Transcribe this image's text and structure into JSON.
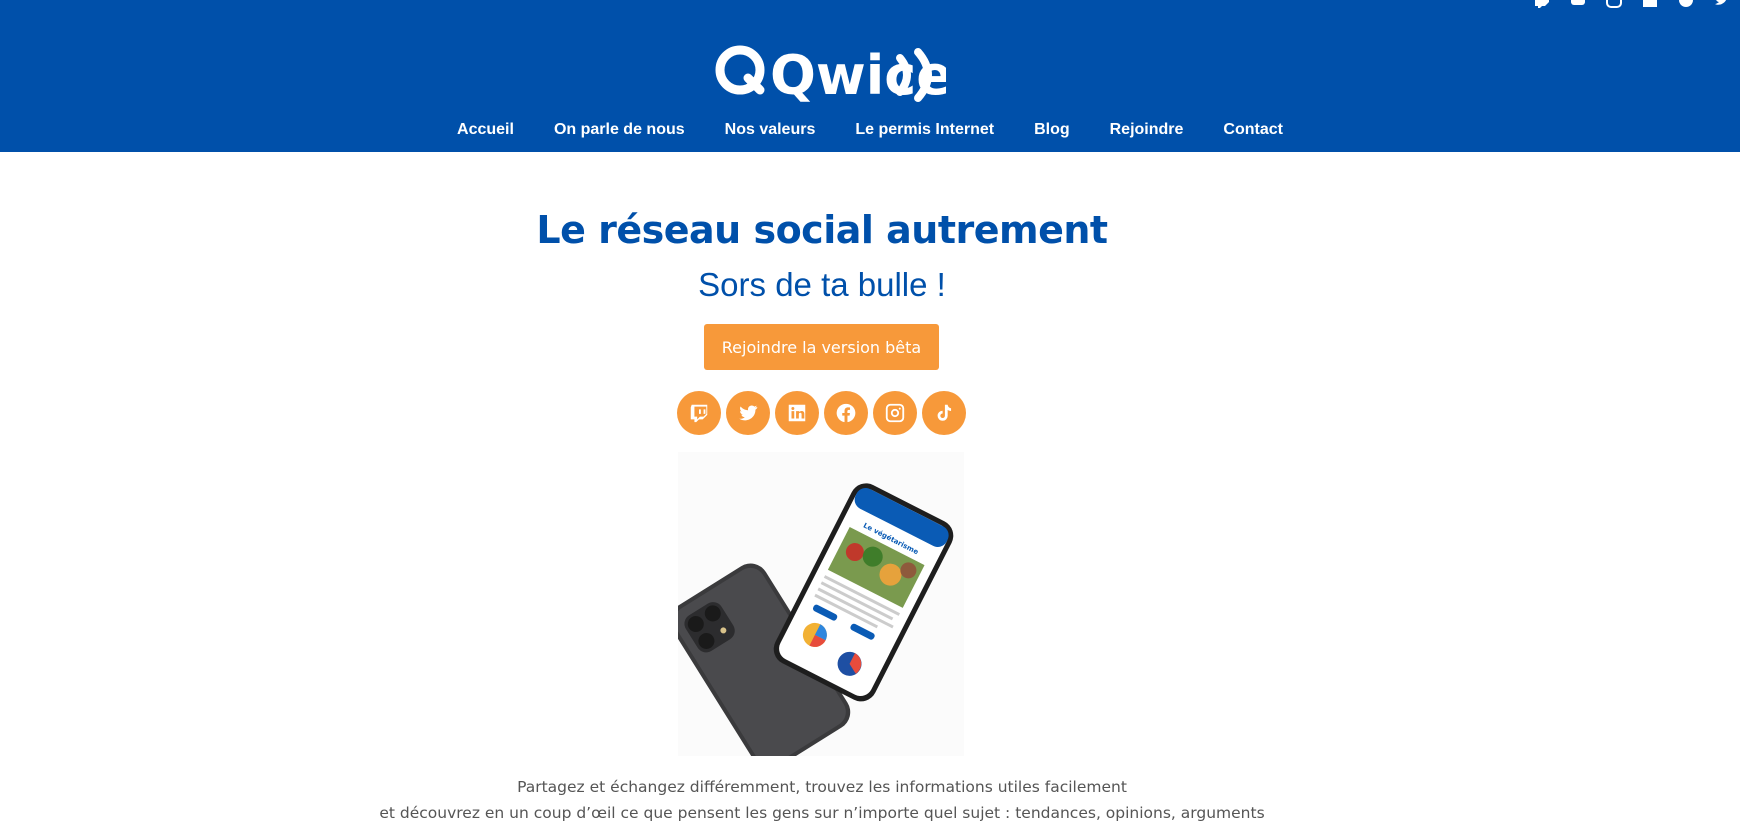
{
  "header": {
    "logo_text": "Qwice",
    "top_social_icons": [
      "twitch-icon",
      "youtube-icon",
      "instagram-icon",
      "linkedin-icon",
      "facebook-icon",
      "twitter-icon"
    ],
    "nav": [
      {
        "label": "Accueil"
      },
      {
        "label": "On parle de nous"
      },
      {
        "label": "Nos valeurs"
      },
      {
        "label": "Le permis Internet"
      },
      {
        "label": "Blog"
      },
      {
        "label": "Rejoindre"
      },
      {
        "label": "Contact"
      }
    ]
  },
  "hero": {
    "title": "Le réseau social autrement",
    "subtitle": "Sors de ta bulle !",
    "cta_label": "Rejoindre la version bêta",
    "social_icons": [
      "twitch-icon",
      "twitter-icon",
      "linkedin-icon",
      "facebook-icon",
      "instagram-icon",
      "tiktok-icon"
    ]
  },
  "phone_screen": {
    "title": "Le végétarisme"
  },
  "description": {
    "line1": "Partagez et échangez différemment, trouvez les informations utiles facilement",
    "line2": "et découvrez en un coup d’œil ce que pensent les gens sur n’importe quel sujet : tendances, opinions, arguments"
  },
  "colors": {
    "brand_blue": "#0050aa",
    "accent_orange": "#f7993a"
  }
}
